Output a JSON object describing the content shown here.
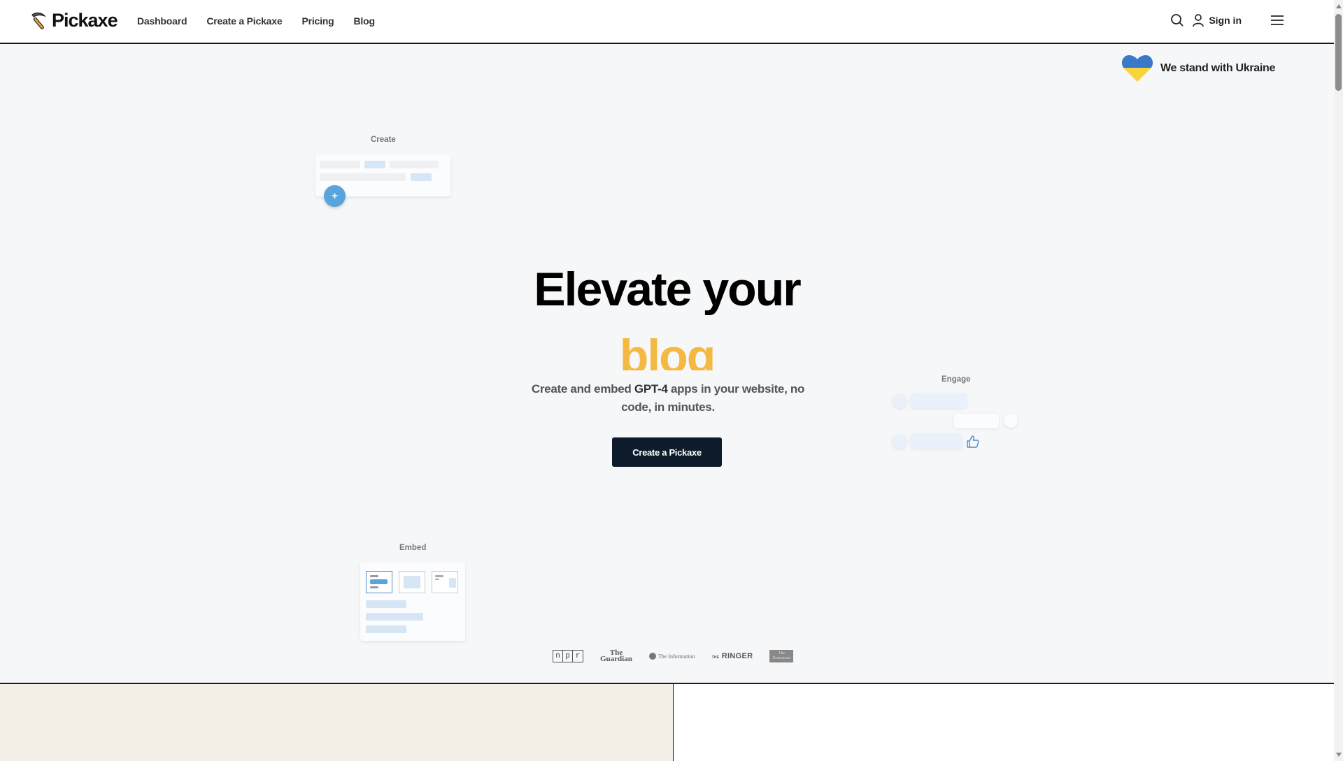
{
  "header": {
    "brand": "Pickaxe",
    "nav": [
      {
        "label": "Dashboard"
      },
      {
        "label": "Create a Pickaxe"
      },
      {
        "label": "Pricing"
      },
      {
        "label": "Blog"
      }
    ],
    "search_icon": "search-icon",
    "user_icon": "user-icon",
    "signin_label": "Sign in",
    "menu_icon": "hamburger-menu-icon"
  },
  "banner": {
    "text": "We stand with Ukraine",
    "icon": "heart-icon",
    "colors": {
      "top": "#3a78c9",
      "bottom": "#f7d33d"
    }
  },
  "features": {
    "create": {
      "label": "Create",
      "button_icon": "plus-icon",
      "button_label": "+"
    },
    "engage": {
      "label": "Engage",
      "icon": "thumbs-up-icon"
    },
    "embed": {
      "label": "Embed"
    }
  },
  "hero": {
    "title": "Elevate your",
    "rotating_word": "blog",
    "subtitle_pre": "Create and embed ",
    "subtitle_bold": "GPT-4",
    "subtitle_post": " apps in your website, no code, in minutes.",
    "cta_label": "Create a Pickaxe",
    "accent_color": "#f4b942",
    "cta_color": "#0e1b2b"
  },
  "press": {
    "logos": [
      "npr",
      "The Guardian",
      "The Information",
      "The Ringer",
      "The Economist"
    ],
    "npr_letters": [
      "n",
      "p",
      "r"
    ],
    "guardian_line1": "The",
    "guardian_line2": "Guardian",
    "information": "The Information",
    "ringer_prefix": "THE",
    "ringer": "RINGER",
    "economist_line1": "The",
    "economist_line2": "Economist"
  }
}
